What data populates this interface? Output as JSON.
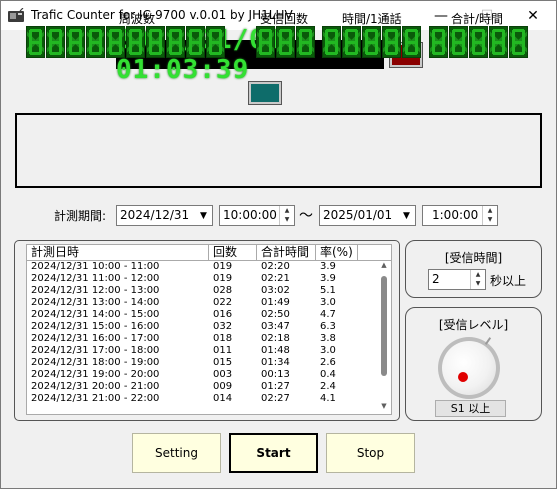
{
  "window": {
    "title": "Trafic Counter for IC-9700 v.0.01 by JH1LHV",
    "minimize": "—",
    "maximize": "☐",
    "close": "✕"
  },
  "clock": {
    "value": "2025/01/01 01:03:39",
    "color": "#33e033"
  },
  "indicators": {
    "red_led_color": "#8a0000",
    "teal_led_color": "#0e6c6a"
  },
  "counters": {
    "frequency_label": "周波数",
    "count_label": "受信回数",
    "time_per_qso_label": "時間/1通話",
    "total_time_label": "合計/時間"
  },
  "period": {
    "label": "計測期間:",
    "start_date": "2024/12/31",
    "start_time": "10:00:00",
    "separator": "～",
    "end_date": "2025/01/01",
    "end_time": "1:00:00"
  },
  "table": {
    "columns": [
      "計測日時",
      "回数",
      "合計時間",
      "率(%)"
    ],
    "rows": [
      [
        "2024/12/31 10:00 - 11:00",
        "019",
        "02:20",
        "3.9"
      ],
      [
        "2024/12/31 11:00 - 12:00",
        "019",
        "02:21",
        "3.9"
      ],
      [
        "2024/12/31 12:00 - 13:00",
        "028",
        "03:02",
        "5.1"
      ],
      [
        "2024/12/31 13:00 - 14:00",
        "022",
        "01:49",
        "3.0"
      ],
      [
        "2024/12/31 14:00 - 15:00",
        "016",
        "02:50",
        "4.7"
      ],
      [
        "2024/12/31 15:00 - 16:00",
        "032",
        "03:47",
        "6.3"
      ],
      [
        "2024/12/31 16:00 - 17:00",
        "018",
        "02:18",
        "3.8"
      ],
      [
        "2024/12/31 17:00 - 18:00",
        "011",
        "01:48",
        "3.0"
      ],
      [
        "2024/12/31 18:00 - 19:00",
        "015",
        "01:34",
        "2.6"
      ],
      [
        "2024/12/31 19:00 - 20:00",
        "003",
        "00:13",
        "0.4"
      ],
      [
        "2024/12/31 20:00 - 21:00",
        "009",
        "01:27",
        "2.4"
      ],
      [
        "2024/12/31 21:00 - 22:00",
        "014",
        "02:27",
        "4.1"
      ]
    ]
  },
  "reception_time": {
    "title": "[受信時間]",
    "value": "2",
    "suffix": "秒以上"
  },
  "reception_level": {
    "title": "[受信レベル]",
    "button_label": "S1 以上"
  },
  "buttons": {
    "setting": "Setting",
    "start": "Start",
    "stop": "Stop"
  }
}
